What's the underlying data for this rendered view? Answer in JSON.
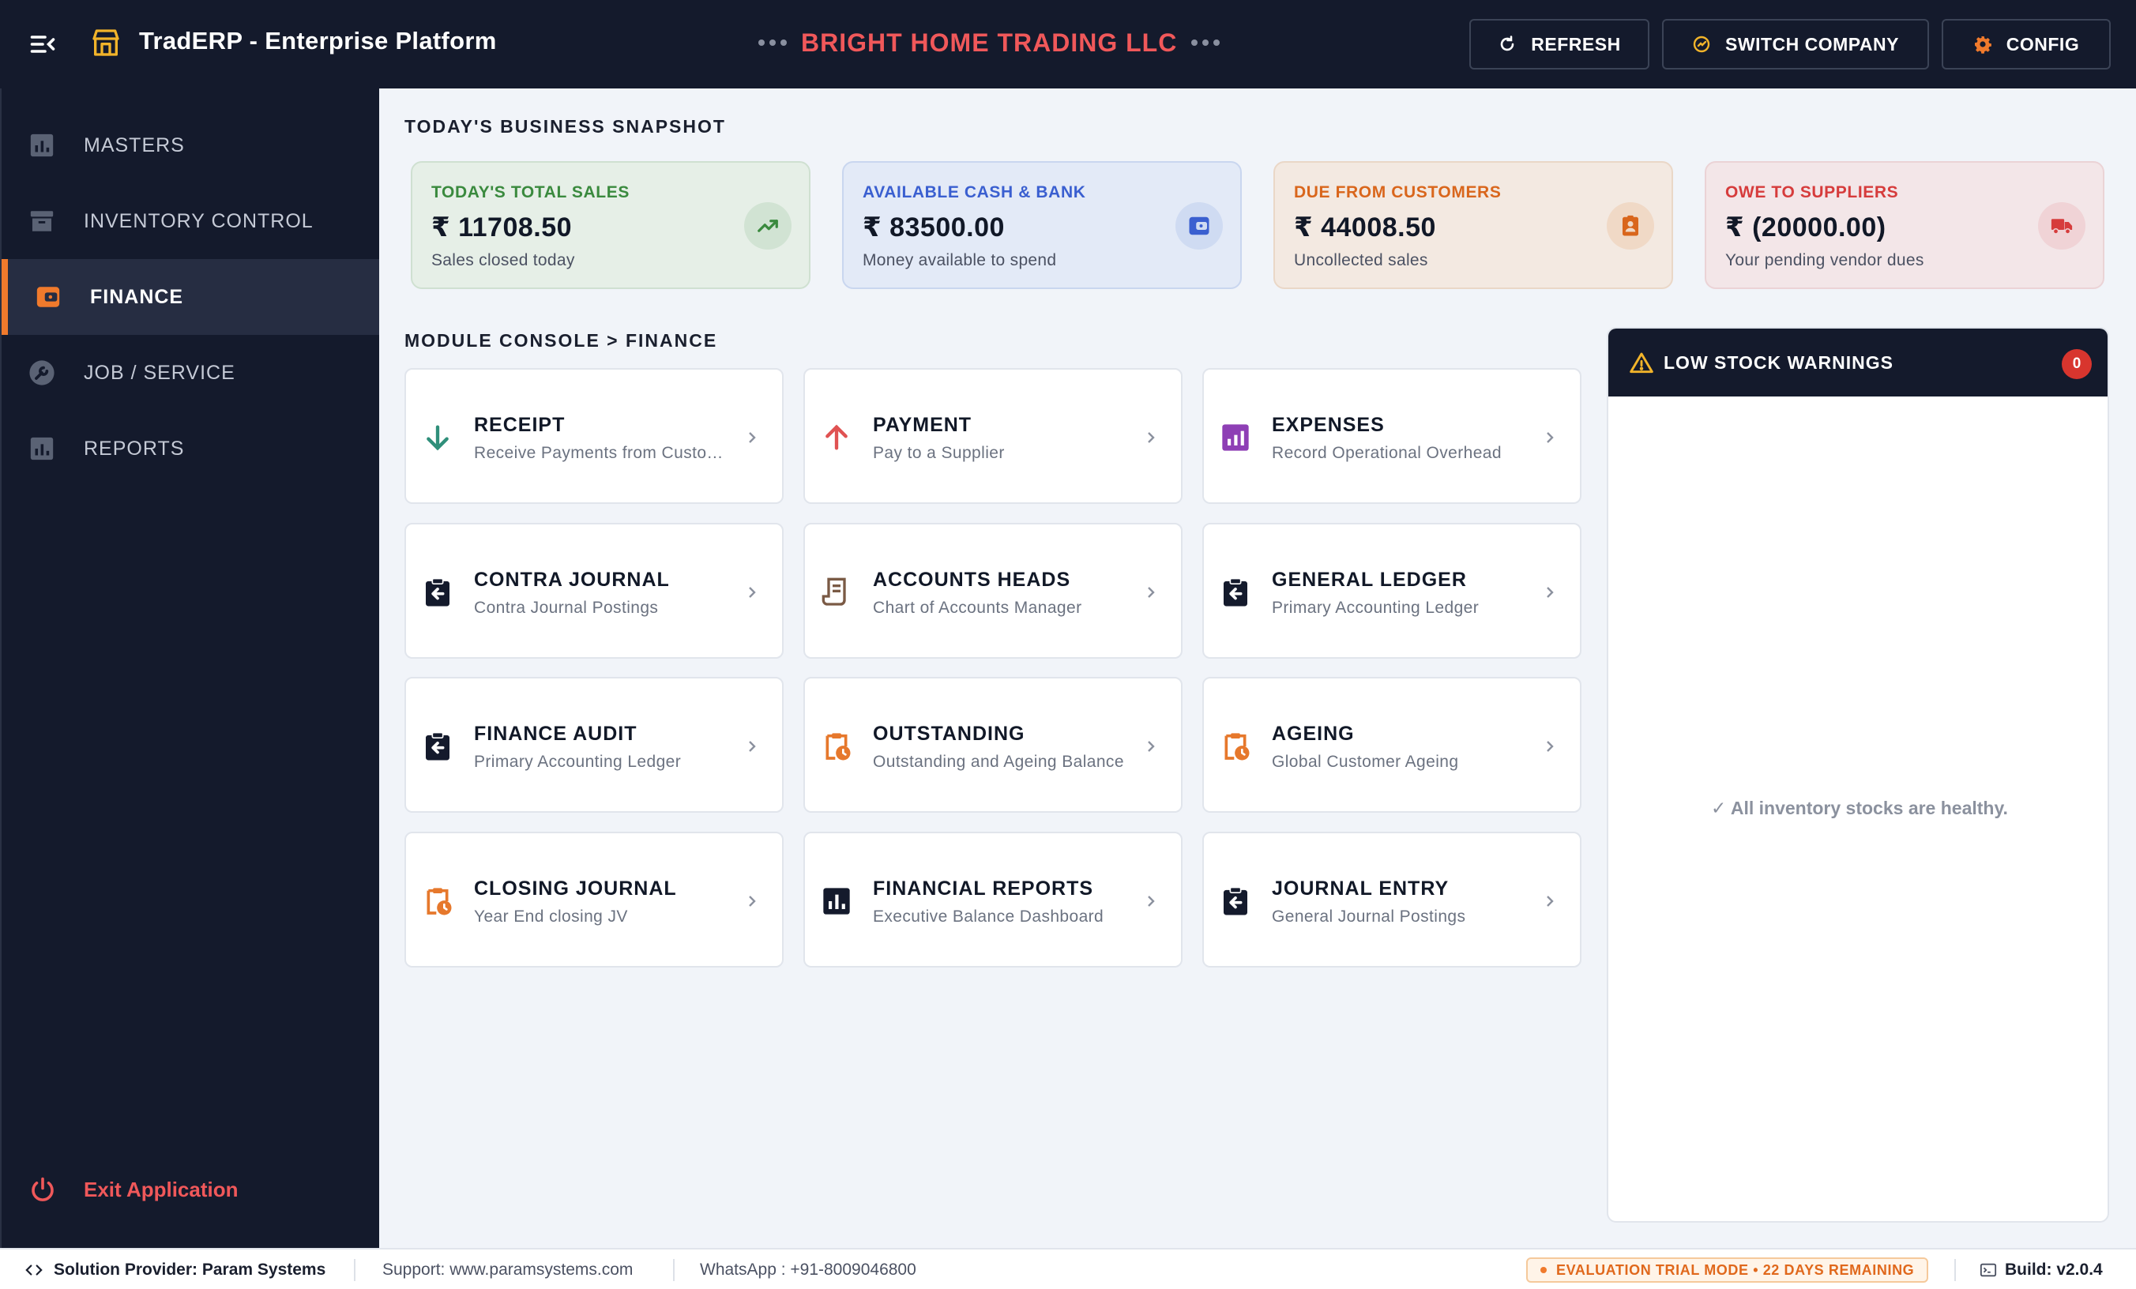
{
  "header": {
    "app_title": "TradERP - Enterprise Platform",
    "company_name": "BRIGHT HOME TRADING LLC",
    "buttons": {
      "refresh": "REFRESH",
      "switch_company": "SWITCH COMPANY",
      "config": "CONFIG"
    }
  },
  "sidebar": {
    "items": [
      {
        "label": "MASTERS",
        "icon": "bar-chart-icon"
      },
      {
        "label": "INVENTORY CONTROL",
        "icon": "archive-icon"
      },
      {
        "label": "FINANCE",
        "icon": "wallet-icon",
        "active": true
      },
      {
        "label": "JOB / SERVICE",
        "icon": "wrench-icon"
      },
      {
        "label": "REPORTS",
        "icon": "bar-chart-icon"
      }
    ],
    "exit_label": "Exit Application"
  },
  "snapshot": {
    "title": "TODAY'S BUSINESS SNAPSHOT",
    "cards": [
      {
        "label": "TODAY'S TOTAL SALES",
        "value": "₹ 11708.50",
        "sub": "Sales closed today",
        "icon": "trending-up-icon",
        "accent": "#3a8a3e"
      },
      {
        "label": "AVAILABLE CASH & BANK",
        "value": "₹ 83500.00",
        "sub": "Money available to spend",
        "icon": "wallet-icon",
        "accent": "#3a5fd0"
      },
      {
        "label": "DUE FROM CUSTOMERS",
        "value": "₹ 44008.50",
        "sub": "Uncollected sales",
        "icon": "contact-badge-icon",
        "accent": "#d9661c"
      },
      {
        "label": "OWE TO SUPPLIERS",
        "value": "₹ (20000.00)",
        "sub": "Your pending vendor dues",
        "icon": "truck-icon",
        "accent": "#d63c3c"
      }
    ]
  },
  "console": {
    "title": "MODULE CONSOLE > FINANCE",
    "modules": [
      {
        "title": "RECEIPT",
        "sub": "Receive Payments from Customers",
        "icon": "arrow-down-icon"
      },
      {
        "title": "PAYMENT",
        "sub": "Pay to a Supplier",
        "icon": "arrow-up-icon"
      },
      {
        "title": "EXPENSES",
        "sub": "Record Operational Overhead",
        "icon": "expense-chart-icon"
      },
      {
        "title": "CONTRA JOURNAL",
        "sub": "Contra Journal Postings",
        "icon": "clipboard-back-icon"
      },
      {
        "title": "ACCOUNTS HEADS",
        "sub": "Chart of Accounts Manager",
        "icon": "receipt-icon"
      },
      {
        "title": "GENERAL LEDGER",
        "sub": "Primary Accounting Ledger",
        "icon": "clipboard-back-icon"
      },
      {
        "title": "FINANCE AUDIT",
        "sub": "Primary Accounting Ledger",
        "icon": "clipboard-back-icon"
      },
      {
        "title": "OUTSTANDING",
        "sub": "Outstanding and Ageing Balance",
        "icon": "clipboard-clock-icon"
      },
      {
        "title": "AGEING",
        "sub": "Global Customer Ageing",
        "icon": "clipboard-clock-icon"
      },
      {
        "title": "CLOSING JOURNAL",
        "sub": "Year End closing JV",
        "icon": "clipboard-clock-icon"
      },
      {
        "title": "FINANCIAL REPORTS",
        "sub": "Executive Balance Dashboard",
        "icon": "report-chart-icon"
      },
      {
        "title": "JOURNAL ENTRY",
        "sub": "General Journal Postings",
        "icon": "clipboard-back-icon"
      }
    ]
  },
  "low_stock": {
    "title": "LOW STOCK WARNINGS",
    "count": "0",
    "empty_message": "✓ All inventory stocks are healthy."
  },
  "footer": {
    "provider": "Solution Provider: Param Systems",
    "support": "Support: www.paramsystems.com",
    "whatsapp": "WhatsApp : +91-8009046800",
    "trial": "EVALUATION TRIAL MODE • 22 DAYS REMAINING",
    "build": "Build: v2.0.4"
  },
  "colors": {
    "topbar_bg": "#141a2c",
    "accent_orange": "#f07a2c",
    "company_red": "#f0585a",
    "content_bg": "#f1f4f9"
  }
}
